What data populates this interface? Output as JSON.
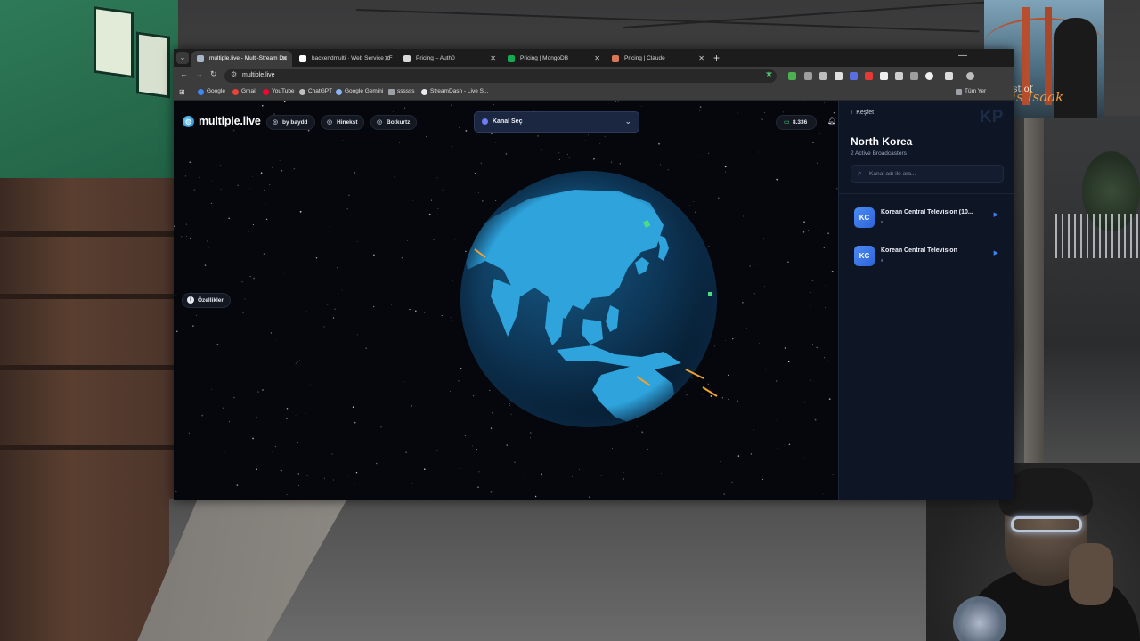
{
  "browser": {
    "tabs": [
      {
        "label": "multiple.live - Multi-Stream Do",
        "active": true,
        "color": "#a8b6c9"
      },
      {
        "label": "backendmulti · Web Service · F",
        "active": false,
        "color": "#ffffff"
      },
      {
        "label": "Pricing – Auth0",
        "active": false,
        "color": "#d9d9d9"
      },
      {
        "label": "Pricing | MongoDB",
        "active": false,
        "color": "#13aa52"
      },
      {
        "label": "Pricing | Claude",
        "active": false,
        "color": "#d97757"
      }
    ],
    "url": "multiple.live",
    "bookmarks": [
      {
        "label": "Google",
        "color": "#4285f4"
      },
      {
        "label": "Gmail",
        "color": "#ea4335"
      },
      {
        "label": "YouTube",
        "color": "#ff0033"
      },
      {
        "label": "ChatGPT",
        "color": "#bfbfbf"
      },
      {
        "label": "Google Gemini",
        "color": "#8ab4f8"
      },
      {
        "label": "ssssss",
        "color": "#9aa0a6"
      },
      {
        "label": "StreamDash - Live S...",
        "color": "#e8eaed"
      }
    ],
    "bookmarks_more": "Tüm Yer"
  },
  "app": {
    "logo": "multiple.live",
    "nav": [
      "by baydd",
      "Hinekst",
      "Botkurtz"
    ],
    "channel_select": "Kanal Seç",
    "viewer_count": "8.336",
    "features_button": "Özellikler"
  },
  "panel": {
    "back_label": "Keşfet",
    "country_code": "KP",
    "title": "North Korea",
    "subtitle": "2 Active Broadcasters",
    "search_placeholder": "Kanal adı ile ara...",
    "channels": [
      {
        "avatar": "KC",
        "name": "Korean Central Television (10..."
      },
      {
        "avatar": "KC",
        "name": "Korean Central Television"
      }
    ]
  },
  "overlay": {
    "album_line1": "best of",
    "album_line2": "Chris Isaak"
  },
  "colors": {
    "accent": "#3b82f6",
    "globe_ocean": "#0f3a5c",
    "globe_land": "#2fa4dd",
    "live_green": "#4ade80"
  }
}
